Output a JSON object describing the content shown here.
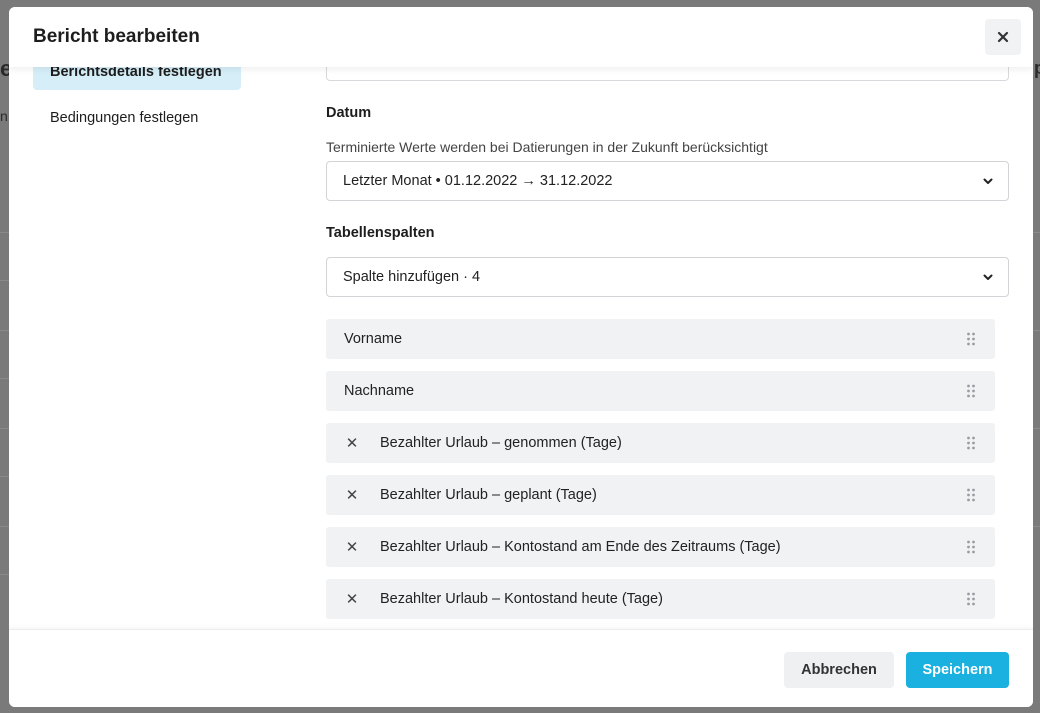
{
  "background": {
    "peek_letters": [
      "e",
      "n",
      "p"
    ]
  },
  "modal": {
    "title": "Bericht bearbeiten",
    "close_icon": "close-icon"
  },
  "sidebar": {
    "items": [
      {
        "label": "Berichtsdetails festlegen",
        "active": true
      },
      {
        "label": "Bedingungen festlegen",
        "active": false
      }
    ]
  },
  "form": {
    "date": {
      "label": "Datum",
      "hint": "Terminierte Werte werden bei Datierungen in der Zukunft berücksichtigt",
      "value": "Letzter Monat • 01.12.2022 → 31.12.2022"
    },
    "columns": {
      "label": "Tabellenspalten",
      "add_value": "Spalte hinzufügen · 4",
      "items": [
        {
          "label": "Vorname",
          "removable": false
        },
        {
          "label": "Nachname",
          "removable": false
        },
        {
          "label": "Bezahlter Urlaub – genommen (Tage)",
          "removable": true
        },
        {
          "label": "Bezahlter Urlaub – geplant (Tage)",
          "removable": true
        },
        {
          "label": "Bezahlter Urlaub – Kontostand am Ende des Zeitraums (Tage)",
          "removable": true
        },
        {
          "label": "Bezahlter Urlaub – Kontostand heute (Tage)",
          "removable": true
        }
      ]
    }
  },
  "footer": {
    "cancel_label": "Abbrechen",
    "save_label": "Speichern"
  },
  "colors": {
    "accent": "#1ab0e0",
    "active_nav_bg": "#d5eef8",
    "row_bg": "#f1f2f3"
  }
}
